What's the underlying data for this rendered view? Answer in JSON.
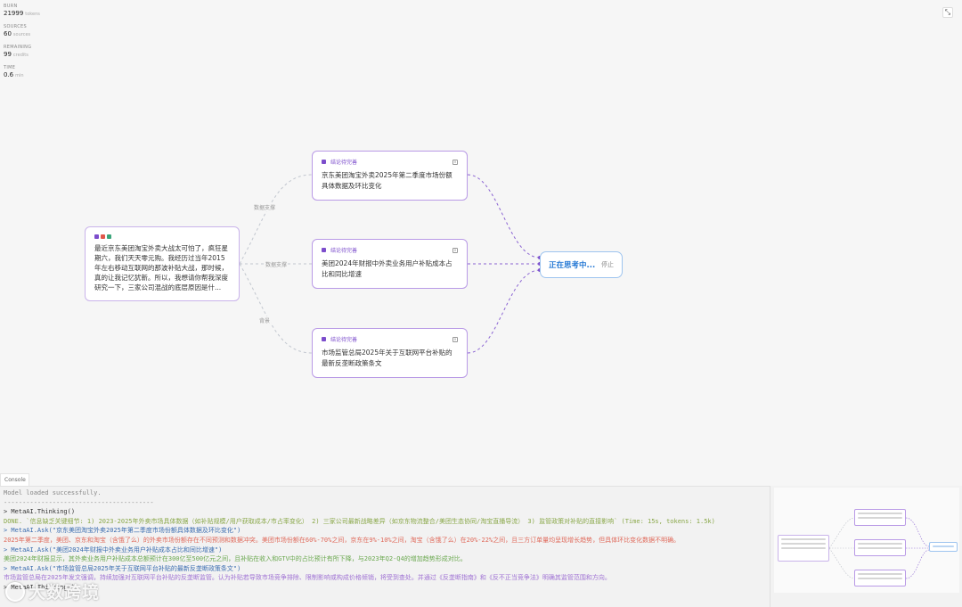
{
  "stats": [
    {
      "label": "BURN",
      "value": "21999",
      "unit": "tokens"
    },
    {
      "label": "SOURCES",
      "value": "60",
      "unit": "sources"
    },
    {
      "label": "REMAINING",
      "value": "99",
      "unit": "credits"
    },
    {
      "label": "TIME",
      "value": "0.6",
      "unit": "min"
    }
  ],
  "source_node": {
    "dot_colors": [
      "#7c4dcc",
      "#e0574b",
      "#3aa57a"
    ],
    "text": "最近京东美团淘宝外卖大战太可怕了，疯狂星期六，我们天天零元购。我经历过当年2015年左右移动互联网的那波补贴大战，那时候，真的让我记忆犹新。所以，我想请你帮我深度研究一下，三家公司混战的底层原因是什..."
  },
  "edge_labels": [
    "数据支撑",
    "数据支撑",
    "背景"
  ],
  "questions": [
    {
      "tag": "结论待完善",
      "text": "京东美团淘宝外卖2025年第二季度市场份额具体数据及环比变化"
    },
    {
      "tag": "结论待完善",
      "text": "美团2024年财报中外卖业务用户补贴成本占比和同比增速"
    },
    {
      "tag": "结论待完善",
      "text": "市场监管总局2025年关于互联网平台补贴的最新反垄断政策条文"
    }
  ],
  "thinking_node": {
    "label": "正在思考中...",
    "stop": "停止"
  },
  "console": {
    "tab": "Console",
    "lines": [
      {
        "cls": "c-grey",
        "text": "Model loaded successfully."
      },
      {
        "cls": "c-grey",
        "text": "----------------------------------------"
      },
      {
        "cls": "c-cmd",
        "text": "> MetaAI.Thinking()"
      },
      {
        "cls": "c-done",
        "text": "DONE. `信息缺乏关键细节: 1) 2023-2025年外卖市场具体数据（如补贴规模/用户获取成本/市占率变化） 2) 三家公司最新战略差异（如京东物流整合/美团生态协同/淘宝直播导流） 3) 监管政策对补贴的直接影响` (Time: 15s, tokens: 1.5k)"
      },
      {
        "cls": "c-cmd",
        "text": "> MetaAI.Ask(\"京东美团淘宝外卖2025年第二季度市场份额具体数据及环比变化\")"
      },
      {
        "cls": "c-red",
        "text": "2025年第二季度，美团、京东和淘宝（含饿了么）的外卖市场份额存在不同预测和数据冲突。美团市场份额在60%-70%之间，京东在9%-10%之间，淘宝（含饿了么）在20%-22%之间，且三方订单量均呈现增长趋势，但具体环比变化数据不明确。"
      },
      {
        "cls": "c-cmd",
        "text": "> MetaAI.Ask(\"美团2024年财报中外卖业务用户补贴成本占比和同比增速\")"
      },
      {
        "cls": "c-green",
        "text": "美团2024年财报显示，其外卖业务用户补贴成本总额预计在300亿至500亿元之间，且补贴在收入和GTV中的占比预计有所下降，与2023年Q2-Q4的增加趋势形成对比。"
      },
      {
        "cls": "c-cmd",
        "text": "> MetaAI.Ask(\"市场监管总局2025年关于互联网平台补贴的最新反垄断政策条文\")"
      },
      {
        "cls": "c-purple",
        "text": "市场监管总局在2025年发文强调，持续加强对互联网平台补贴的反垄断监管。认为补贴若导致市场竞争排除、限制影响或构成价格倾销，将受到查处。并通过《反垄断指南》和《反不正当竞争法》明确其监管范围和方向。"
      },
      {
        "cls": "c-cmd",
        "text": "> MetaAI.Thinking()"
      }
    ]
  },
  "watermark": "大数跨境",
  "collapse_icon": "⤡"
}
